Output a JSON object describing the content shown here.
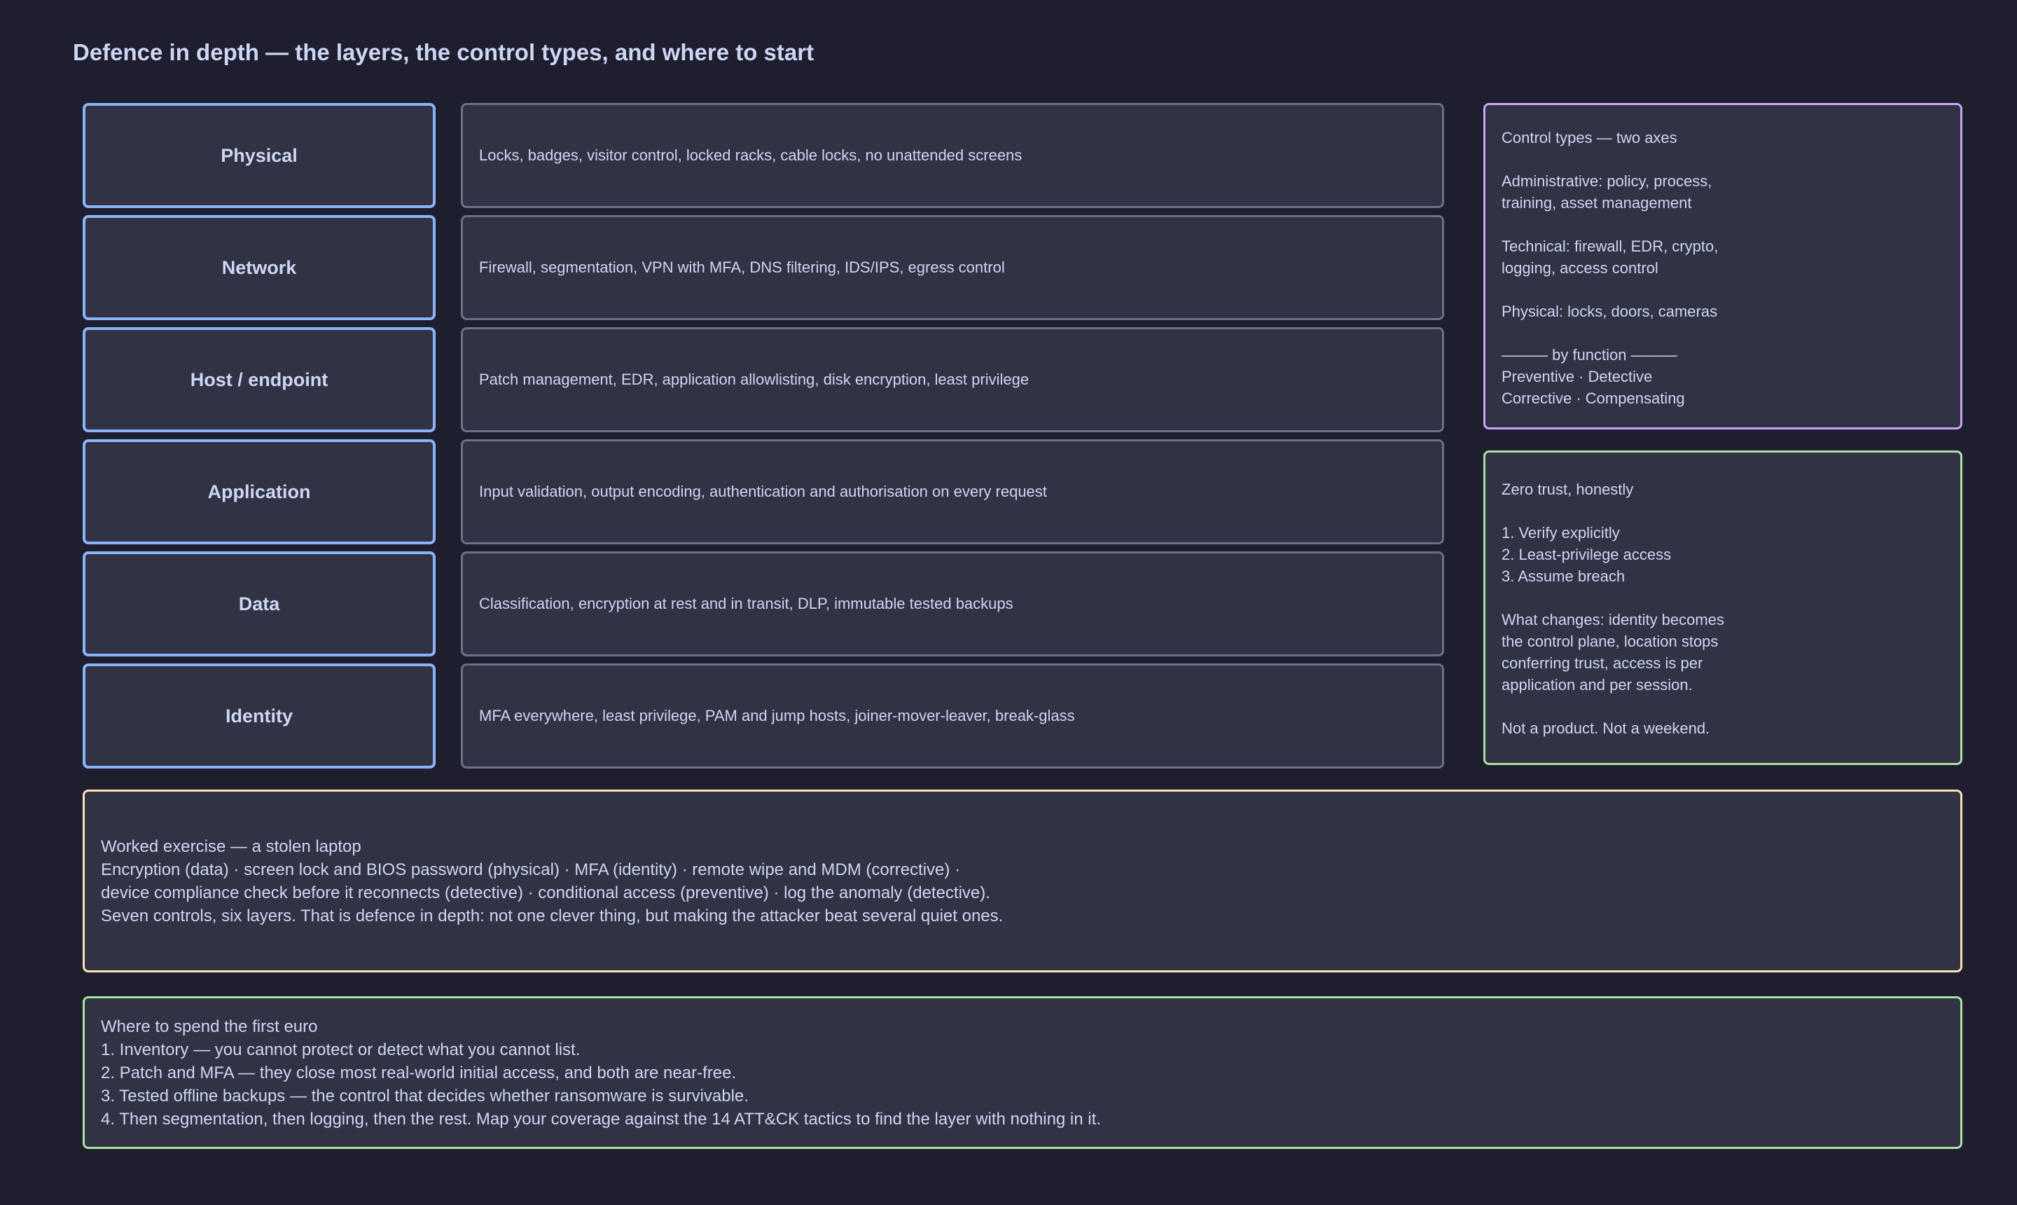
{
  "title": "Defence in depth — the layers, the control types, and where to start",
  "colors": {
    "background": "#1e1e2e",
    "box_fill": "#313244",
    "layer_border": "#89b4fa",
    "desc_border": "#6c7086",
    "control_types_border": "#cba6f7",
    "zero_trust_border": "#a6e3a1",
    "exercise_border": "#f9e2af",
    "first_euro_border": "#a6e3a1",
    "text": "#cdd6f4"
  },
  "layers": [
    {
      "name": "Physical",
      "controls": "Locks, badges, visitor control, locked racks, cable locks, no unattended screens"
    },
    {
      "name": "Network",
      "controls": "Firewall, segmentation, VPN with MFA, DNS filtering, IDS/IPS, egress control"
    },
    {
      "name": "Host / endpoint",
      "controls": "Patch management, EDR, application allowlisting, disk encryption, least privilege"
    },
    {
      "name": "Application",
      "controls": "Input validation, output encoding, authentication and authorisation on every request"
    },
    {
      "name": "Data",
      "controls": "Classification, encryption at rest and in transit, DLP, immutable tested backups"
    },
    {
      "name": "Identity",
      "controls": "MFA everywhere, least privilege, PAM and jump hosts, joiner-mover-leaver, break-glass"
    }
  ],
  "control_types": {
    "lines": [
      "Control types — two axes",
      "",
      "Administrative: policy, process,",
      "training, asset management",
      "",
      "Technical: firewall, EDR, crypto,",
      "logging, access control",
      "",
      "Physical: locks, doors, cameras",
      "",
      "——— by function ———",
      "Preventive · Detective",
      "Corrective · Compensating"
    ]
  },
  "zero_trust": {
    "lines": [
      "Zero trust, honestly",
      "",
      "1. Verify explicitly",
      "2. Least-privilege access",
      "3. Assume breach",
      "",
      "What changes: identity becomes",
      "the control plane, location stops",
      "conferring trust, access is per",
      "application and per session.",
      "",
      "Not a product. Not a weekend."
    ]
  },
  "worked_exercise": {
    "lines": [
      "Worked exercise — a stolen laptop",
      "Encryption (data) · screen lock and BIOS password (physical) · MFA (identity) · remote wipe and MDM (corrective) ·",
      "device compliance check before it reconnects (detective) · conditional access (preventive) · log the anomaly (detective).",
      "Seven controls, six layers. That is defence in depth: not one clever thing, but making the attacker beat several quiet ones."
    ]
  },
  "first_euro": {
    "lines": [
      "Where to spend the first euro",
      "1. Inventory — you cannot protect or detect what you cannot list.",
      "2. Patch and MFA — they close most real-world initial access, and both are near-free.",
      "3. Tested offline backups — the control that decides whether ransomware is survivable.",
      "4. Then segmentation, then logging, then the rest. Map your coverage against the 14 ATT&CK tactics to find the layer with nothing in it."
    ]
  }
}
